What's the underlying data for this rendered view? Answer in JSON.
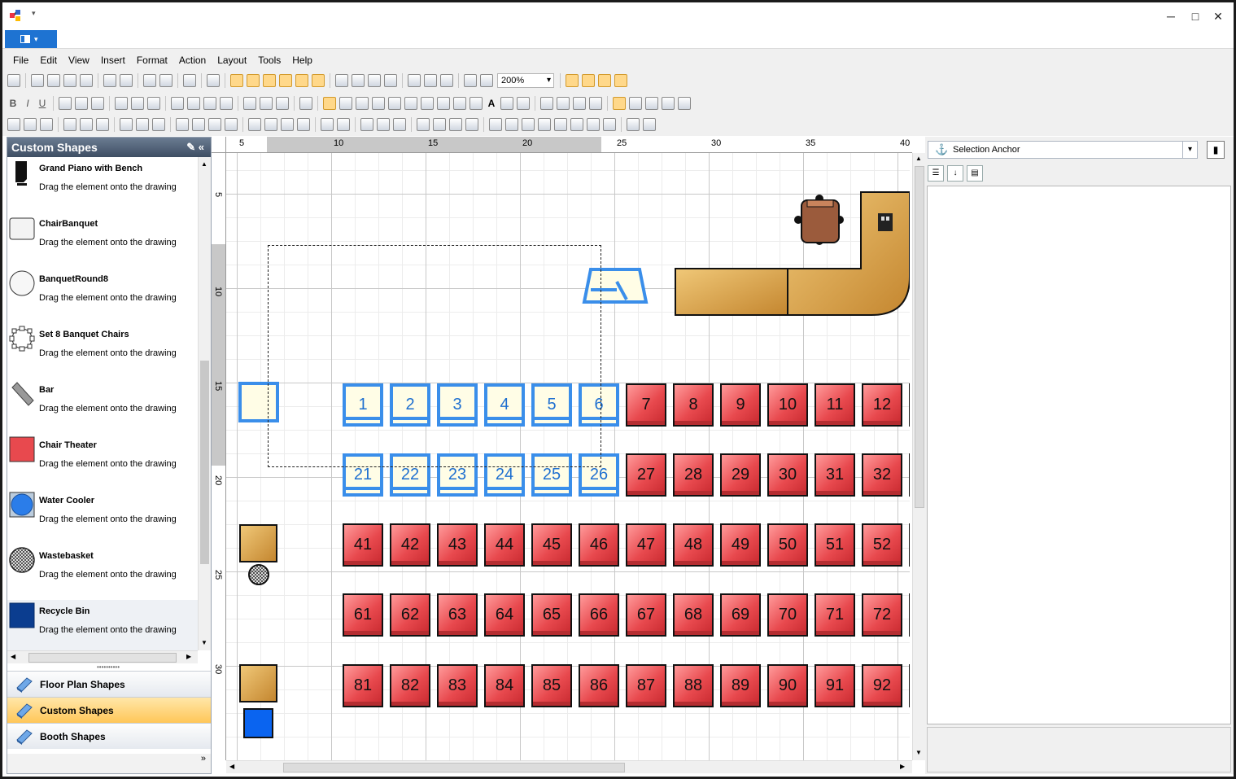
{
  "title_bar": {
    "quick_access_caret": "▾",
    "minimize": "─",
    "maximize": "□",
    "close": "✕"
  },
  "menu": [
    "File",
    "Edit",
    "View",
    "Insert",
    "Format",
    "Action",
    "Layout",
    "Tools",
    "Help"
  ],
  "toolbar": {
    "zoom": "200%",
    "font_bold": "B",
    "font_italic": "I",
    "font_underline": "U",
    "text_tool": "A"
  },
  "left_panel": {
    "title": "Custom Shapes",
    "items": [
      {
        "name": "Grand Piano with Bench",
        "desc": "Drag the element onto the drawing"
      },
      {
        "name": "ChairBanquet",
        "desc": "Drag the element onto the drawing"
      },
      {
        "name": "BanquetRound8",
        "desc": "Drag the element onto the drawing"
      },
      {
        "name": "Set 8 Banquet Chairs",
        "desc": "Drag the element onto the drawing"
      },
      {
        "name": "Bar",
        "desc": "Drag the element onto the drawing"
      },
      {
        "name": "Chair Theater",
        "desc": "Drag the element onto the drawing"
      },
      {
        "name": "Water Cooler",
        "desc": "Drag the element onto the drawing"
      },
      {
        "name": "Wastebasket",
        "desc": "Drag the element onto the drawing"
      },
      {
        "name": "Recycle Bin",
        "desc": "Drag the element onto the drawing"
      }
    ],
    "categories": [
      {
        "label": "Floor Plan Shapes",
        "selected": false
      },
      {
        "label": "Custom Shapes",
        "selected": true
      },
      {
        "label": "Booth Shapes",
        "selected": false
      }
    ]
  },
  "ruler": {
    "top": [
      "5",
      "10",
      "15",
      "20",
      "25",
      "30",
      "35",
      "40"
    ],
    "left": [
      "5",
      "10",
      "15",
      "20",
      "25",
      "30"
    ]
  },
  "seats": {
    "row1": [
      "1",
      "2",
      "3",
      "4",
      "5",
      "6",
      "7",
      "8",
      "9",
      "10",
      "11",
      "12"
    ],
    "row2": [
      "21",
      "22",
      "23",
      "24",
      "25",
      "26",
      "27",
      "28",
      "29",
      "30",
      "31",
      "32"
    ],
    "row3": [
      "41",
      "42",
      "43",
      "44",
      "45",
      "46",
      "47",
      "48",
      "49",
      "50",
      "51",
      "52"
    ],
    "row4": [
      "61",
      "62",
      "63",
      "64",
      "65",
      "66",
      "67",
      "68",
      "69",
      "70",
      "71",
      "72"
    ],
    "row5": [
      "81",
      "82",
      "83",
      "84",
      "85",
      "86",
      "87",
      "88",
      "89",
      "90",
      "91",
      "92"
    ],
    "selected_count_per_row": 6
  },
  "properties": {
    "object": "Selection Anchor"
  },
  "colors": {
    "seat": "#e8494e",
    "selected": "#3a8eea",
    "wood": "#d9a24f",
    "water": "#0a64f0",
    "titlebar_btn": "#1e73d2"
  }
}
